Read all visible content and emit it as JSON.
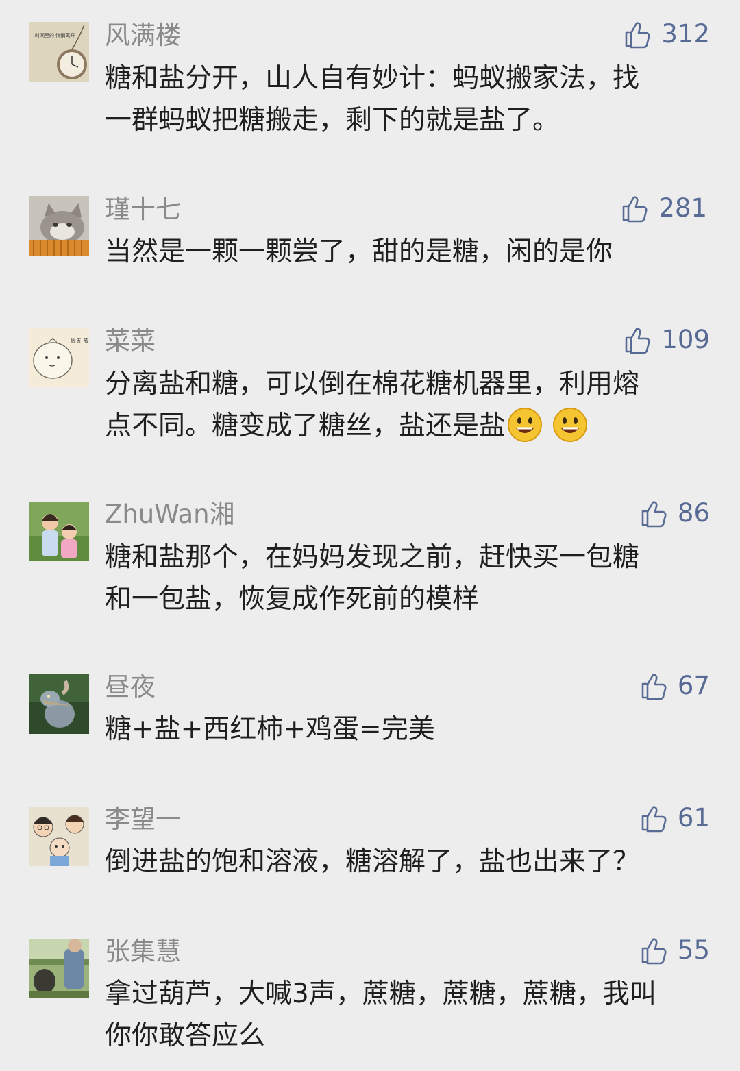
{
  "comments": [
    {
      "name": "风满楼",
      "likes": "312",
      "lines": [
        "糖和盐分开，山人自有妙计：蚂蚁搬家法，找",
        "一群蚂蚁把糖搬走，剩下的就是盐了。"
      ],
      "avatar_text": "时间里的 悄悄离开"
    },
    {
      "name": "瑾十七",
      "likes": "281",
      "lines": [
        "当然是一颗一颗尝了，甜的是糖，闲的是你"
      ]
    },
    {
      "name": "菜菜",
      "likes": "109",
      "lines": [
        "分离盐和糖，可以倒在棉花糖机器里，利用熔",
        "点不同。糖变成了糖丝，盐还是盐"
      ],
      "avatar_text": "周五 放学 别走",
      "emojis": [
        "smiley",
        "smiley"
      ]
    },
    {
      "name": "ZhuWan湘",
      "likes": "86",
      "lines": [
        "糖和盐那个，在妈妈发现之前，赶快买一包糖",
        "和一包盐，恢复成作死前的模样"
      ]
    },
    {
      "name": "昼夜",
      "likes": "67",
      "lines": [
        "糖+盐+西红柿+鸡蛋=完美"
      ]
    },
    {
      "name": "李望一",
      "likes": "61",
      "lines": [
        "倒进盐的饱和溶液，糖溶解了，盐也出来了？"
      ]
    },
    {
      "name": "张集慧",
      "likes": "55",
      "lines": [
        "拿过葫芦，大喊3声，蔗糖，蔗糖，蔗糖，我叫",
        "你你敢答应么"
      ]
    }
  ],
  "icons": {
    "like": "thumbs-up-icon",
    "emoji": "smiley-emoji"
  },
  "colors": {
    "background": "#ededed",
    "name": "#8a8a8a",
    "likes": "#586b95",
    "text": "#1f1f1f"
  }
}
